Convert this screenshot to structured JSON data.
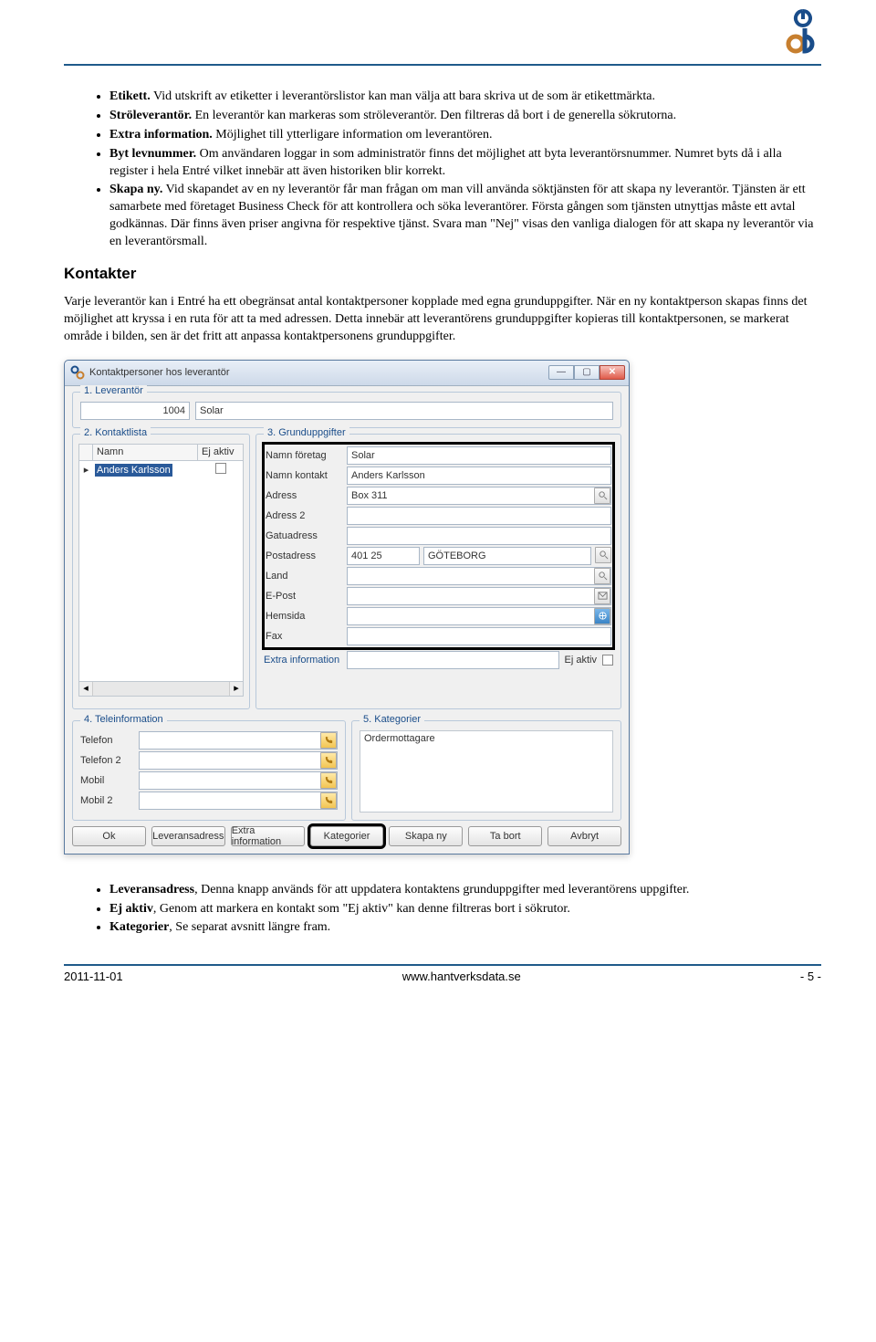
{
  "bullets_top": [
    {
      "b": "Etikett.",
      "t": " Vid utskrift av etiketter i leverantörslistor kan man välja att bara skriva ut de som är etikettmärkta."
    },
    {
      "b": "Ströleverantör.",
      "t": " En leverantör kan markeras som ströleverantör. Den filtreras då bort i de generella sökrutorna."
    },
    {
      "b": "Extra information.",
      "t": " Möjlighet till ytterligare information om leverantören."
    },
    {
      "b": "Byt levnummer.",
      "t": " Om användaren loggar in som administratör finns det möjlighet att byta leverantörsnummer. Numret byts då i alla register i hela Entré vilket innebär att även historiken blir korrekt."
    },
    {
      "b": "Skapa ny.",
      "t": " Vid skapandet av en ny leverantör får man frågan om man vill använda söktjänsten för att skapa ny leverantör. Tjänsten är ett samarbete med företaget Business Check för att kontrollera och söka leverantörer. Första gången som tjänsten utnyttjas måste ett avtal godkännas. Där finns även priser angivna för respektive tjänst. Svara man \"Nej\" visas den vanliga dialogen för att skapa ny leverantör via en leverantörsmall."
    }
  ],
  "section_heading": "Kontakter",
  "para": "Varje leverantör kan i Entré ha ett obegränsat antal kontaktpersoner kopplade med egna grunduppgifter. När en ny kontaktperson skapas   finns det möjlighet att kryssa i en ruta för att ta med adressen. Detta innebär att leverantörens grunduppgifter kopieras till kontaktpersonen, se markerat område i bilden, sen är det fritt att anpassa kontaktpersonens grunduppgifter.",
  "win": {
    "title": "Kontaktpersoner hos leverantör",
    "g1": {
      "legend": "1. Leverantör",
      "id": "1004",
      "name": "Solar"
    },
    "g2": {
      "legend": "2. Kontaktlista",
      "h1": "Namn",
      "h2": "Ej aktiv",
      "sel": "Anders Karlsson"
    },
    "g3": {
      "legend": "3. Grunduppgifter",
      "rows": {
        "namnforetag": {
          "l": "Namn företag",
          "v": "Solar"
        },
        "namnkontakt": {
          "l": "Namn kontakt",
          "v": "Anders Karlsson"
        },
        "adress": {
          "l": "Adress",
          "v": "Box 311"
        },
        "adress2": {
          "l": "Adress 2",
          "v": ""
        },
        "gatuadress": {
          "l": "Gatuadress",
          "v": ""
        },
        "postadress": {
          "l": "Postadress",
          "pc": "401 25",
          "city": "GÖTEBORG"
        },
        "land": {
          "l": "Land",
          "v": ""
        },
        "epost": {
          "l": "E-Post",
          "v": ""
        },
        "hemsida": {
          "l": "Hemsida",
          "v": ""
        },
        "fax": {
          "l": "Fax",
          "v": ""
        }
      },
      "extra_l": "Extra information",
      "extra_r": "Ej aktiv"
    },
    "g4": {
      "legend": "4. Teleinformation",
      "rows": {
        "telefon": {
          "l": "Telefon"
        },
        "telefon2": {
          "l": "Telefon 2"
        },
        "mobil": {
          "l": "Mobil"
        },
        "mobil2": {
          "l": "Mobil 2"
        }
      }
    },
    "g5": {
      "legend": "5. Kategorier",
      "item": "Ordermottagare"
    },
    "buttons": {
      "ok": "Ok",
      "lev": "Leveransadress",
      "extra": "Extra information",
      "kat": "Kategorier",
      "skapa": "Skapa ny",
      "tabort": "Ta bort",
      "avbryt": "Avbryt"
    }
  },
  "bullets_bottom": [
    {
      "b": "Leveransadress",
      "t": ", Denna knapp används för att uppdatera kontaktens grunduppgifter med leverantörens uppgifter."
    },
    {
      "b": "Ej aktiv",
      "t": ", Genom att markera en kontakt som \"Ej aktiv\" kan denne filtreras bort i sökrutor."
    },
    {
      "b": "Kategorier",
      "t": ", Se separat avsnitt längre fram."
    }
  ],
  "footer": {
    "date": "2011-11-01",
    "url": "www.hantverksdata.se",
    "page": "- 5 -"
  }
}
